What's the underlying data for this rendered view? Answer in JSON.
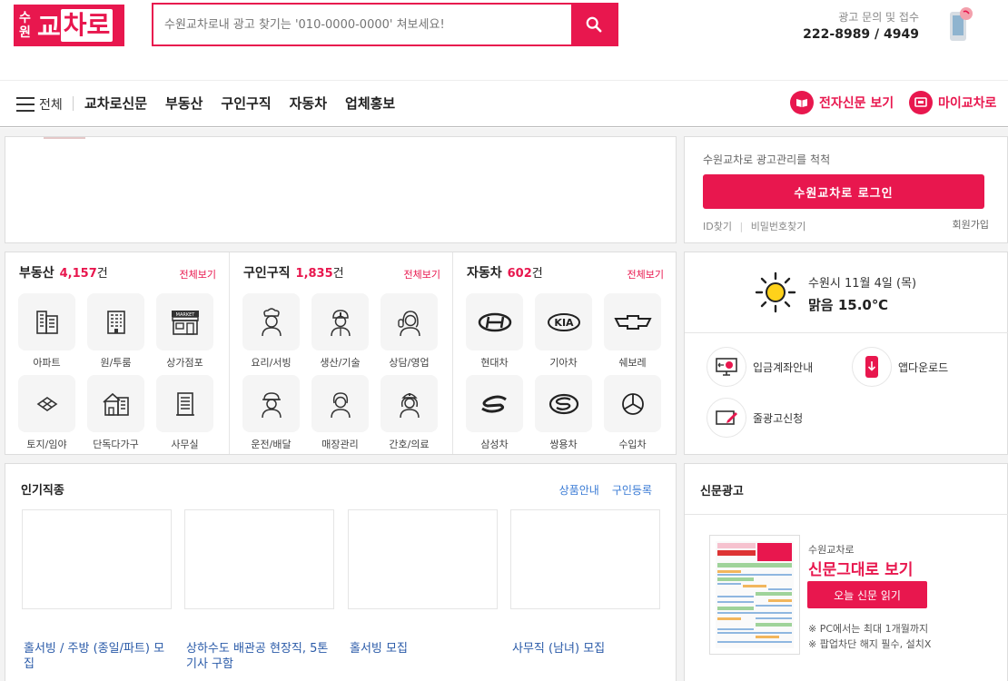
{
  "header": {
    "logo_small": "수원",
    "logo_main": "교",
    "logo_box": "차로",
    "search_placeholder": "수원교차로내 광고 찾기는 '010-0000-0000' 쳐보세요!",
    "contact_label": "광고 문의 및 접수",
    "contact_phone": "222-8989 / 4949"
  },
  "nav": {
    "all_label": "전체",
    "items": [
      "교차로신문",
      "부동산",
      "구인구직",
      "자동차",
      "업체홍보"
    ],
    "epaper_label": "전자신문 보기",
    "my_label": "마이교차로"
  },
  "login": {
    "text": "수원교차로 광고관리를 척척",
    "button": "수원교차로 로그인",
    "find_id": "ID찾기",
    "find_pw": "비밀번호찾기",
    "join": "회원가입"
  },
  "categories": [
    {
      "title": "부동산",
      "count": "4,157",
      "unit": "건",
      "more": "전체보기",
      "items": [
        {
          "label": "아파트",
          "icon": "apartment-icon"
        },
        {
          "label": "원/투룸",
          "icon": "building-icon"
        },
        {
          "label": "상가점포",
          "icon": "market-icon"
        },
        {
          "label": "토지/임야",
          "icon": "land-icon"
        },
        {
          "label": "단독다가구",
          "icon": "house-icon"
        },
        {
          "label": "사무실",
          "icon": "office-icon"
        }
      ]
    },
    {
      "title": "구인구직",
      "count": "1,835",
      "unit": "건",
      "more": "전체보기",
      "items": [
        {
          "label": "요리/서빙",
          "icon": "chef-icon"
        },
        {
          "label": "생산/기술",
          "icon": "worker-icon"
        },
        {
          "label": "상담/영업",
          "icon": "operator-icon"
        },
        {
          "label": "운전/배달",
          "icon": "driver-icon"
        },
        {
          "label": "매장관리",
          "icon": "clerk-icon"
        },
        {
          "label": "간호/의료",
          "icon": "nurse-icon"
        }
      ]
    },
    {
      "title": "자동차",
      "count": "602",
      "unit": "건",
      "more": "전체보기",
      "items": [
        {
          "label": "현대차",
          "icon": "hyundai-logo-icon"
        },
        {
          "label": "기아차",
          "icon": "kia-logo-icon"
        },
        {
          "label": "쉐보레",
          "icon": "chevrolet-logo-icon"
        },
        {
          "label": "삼성차",
          "icon": "samsung-logo-icon"
        },
        {
          "label": "쌍용차",
          "icon": "ssangyong-logo-icon"
        },
        {
          "label": "수입차",
          "icon": "mercedes-logo-icon"
        }
      ]
    }
  ],
  "weather": {
    "date": "수원시 11월 4일 (목)",
    "condition": "맑음",
    "temp": "15.0℃",
    "services": [
      {
        "label": "입금계좌안내",
        "icon": "bank-monitor-icon"
      },
      {
        "label": "앱다운로드",
        "icon": "mobile-download-icon"
      },
      {
        "label": "줄광고신청",
        "icon": "edit-ad-icon"
      }
    ]
  },
  "popular": {
    "title": "인기직종",
    "tabs": [
      "상품안내",
      "구인등록"
    ],
    "jobs": [
      "홀서빙 / 주방 (종일/파트) 모집",
      "상하수도 배관공 현장직, 5톤기사 구함",
      "홀서빙 모집",
      "사무직 (남녀) 모집"
    ]
  },
  "paper": {
    "title": "신문광고",
    "sub": "수원교차로",
    "big": "신문그대로 보기",
    "button": "오늘 신문 읽기",
    "notes": [
      "※ PC에서는 최대 1개월까지",
      "※ 팝업차단 해지 필수, 설치X"
    ]
  },
  "colors": {
    "accent": "#e8174e",
    "link": "#2a5aa8"
  }
}
